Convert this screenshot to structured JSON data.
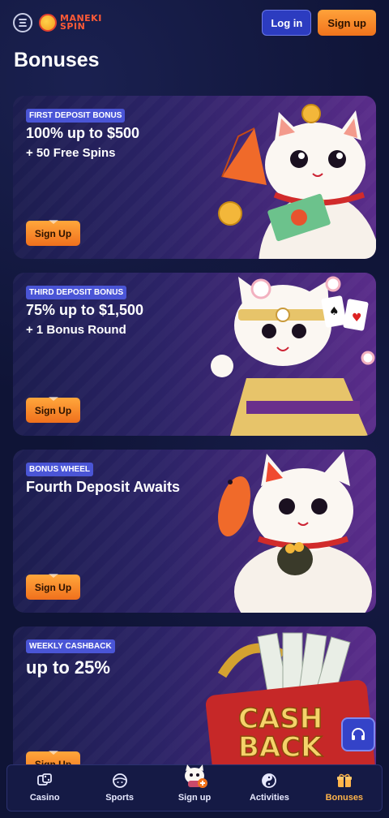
{
  "header": {
    "logo_text_line1": "MANEKI",
    "logo_text_line2": "SPIN",
    "login_label": "Log in",
    "signup_label": "Sign up"
  },
  "page": {
    "title": "Bonuses"
  },
  "bonuses": [
    {
      "badge": "FIRST DEPOSIT BONUS",
      "title": "100% up to $500",
      "subtitle": "+ 50 Free Spins",
      "cta": "Sign Up"
    },
    {
      "badge": "THIRD DEPOSIT BONUS",
      "title": "75% up to $1,500",
      "subtitle": "+ 1 Bonus Round",
      "cta": "Sign Up"
    },
    {
      "badge": "BONUS WHEEL",
      "title": "Fourth Deposit Awaits",
      "subtitle": "",
      "cta": "Sign Up"
    },
    {
      "badge": "WEEKLY CASHBACK",
      "title": "up to 25%",
      "subtitle": "",
      "cta": "Sign Up",
      "art_text_1": "CASH",
      "art_text_2": "BACK"
    }
  ],
  "bottom_nav": [
    {
      "label": "Casino",
      "icon": "dice-icon"
    },
    {
      "label": "Sports",
      "icon": "ball-icon"
    },
    {
      "label": "Sign up",
      "icon": "cat-plus-icon"
    },
    {
      "label": "Activities",
      "icon": "yin-yang-icon"
    },
    {
      "label": "Bonuses",
      "icon": "gift-icon",
      "active": true
    }
  ],
  "colors": {
    "accent_orange": "#f0731c",
    "accent_blue": "#2c3cc0",
    "background": "#0f1436",
    "active_nav": "#ffb44a"
  }
}
